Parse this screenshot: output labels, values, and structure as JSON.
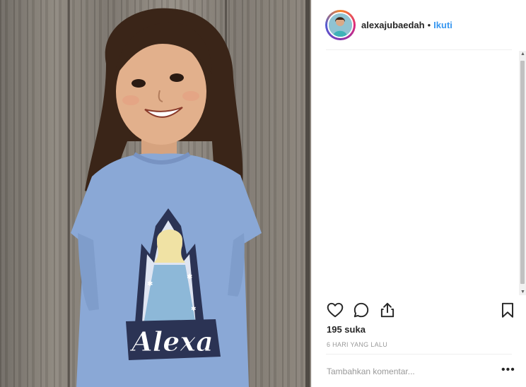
{
  "post": {
    "username": "alexajubaedah",
    "separator": "•",
    "follow_label": "Ikuti",
    "likes": "195 suka",
    "time_ago": "6 HARI YANG LALU",
    "comment_placeholder": "Tambahkan komentar...",
    "more_label": "•••"
  },
  "photo": {
    "shirt_print_text": "Alexa"
  },
  "icons": {
    "like": "heart-icon",
    "comment": "comment-icon",
    "share": "share-icon",
    "save": "bookmark-icon"
  },
  "colors": {
    "follow": "#3897f0",
    "text": "#262626",
    "muted": "#999999",
    "shirt": "#8aa8d6"
  }
}
